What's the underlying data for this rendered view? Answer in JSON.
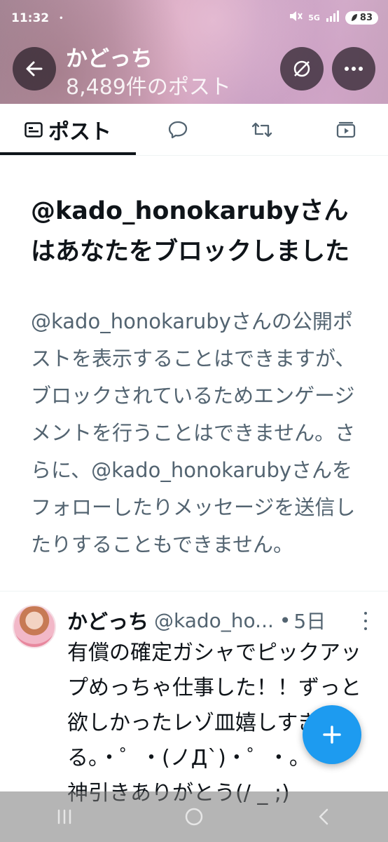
{
  "status_bar": {
    "time": "11:32",
    "dot": "•",
    "network": "5G",
    "battery": "83"
  },
  "header": {
    "name": "かどっち",
    "post_count": "8,489件のポスト"
  },
  "tabs": [
    {
      "label": "ポスト",
      "icon": "posts-icon",
      "selected": true
    },
    {
      "label": "",
      "icon": "reply-icon"
    },
    {
      "label": "",
      "icon": "repost-icon"
    },
    {
      "label": "",
      "icon": "media-icon"
    }
  ],
  "blocked": {
    "title": "@kado_honokarubyさんはあなたをブロックしました",
    "description": "@kado_honokarubyさんの公開ポストを表示することはできますが、ブロックされているためエンゲージメントを行うことはできません。さらに、@kado_honokarubyさんをフォローしたりメッセージを送信したりすることもできません。"
  },
  "post": {
    "name": "かどっち",
    "handle": "@kado_ho...",
    "dot": "•",
    "time": "5日",
    "text": "有償の確定ガシャでピックアップめっちゃ仕事した！！ずっと欲しかったレゾ皿嬉しすぎる。・゜・(ノД`)・゜・。\n神引きありがとう(/ _ ;)"
  },
  "colors": {
    "accent": "#1d9bf0",
    "text": "#0f1419",
    "secondary_text": "#536471"
  }
}
